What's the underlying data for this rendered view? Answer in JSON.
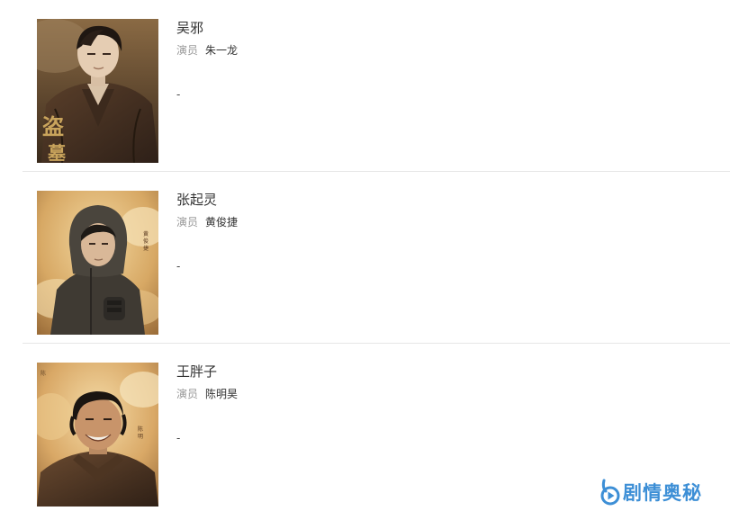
{
  "cast": [
    {
      "role": "吴邪",
      "actor_label": "演员",
      "actor": "朱一龙",
      "description": "-",
      "portrait_icon": "character-portrait-brown-coat",
      "poster_text": "盗墓"
    },
    {
      "role": "张起灵",
      "actor_label": "演员",
      "actor": "黄俊捷",
      "description": "-",
      "portrait_icon": "character-portrait-hooded"
    },
    {
      "role": "王胖子",
      "actor_label": "演员",
      "actor": "陈明昊",
      "description": "-",
      "portrait_icon": "character-portrait-leather-jacket"
    }
  ],
  "watermark": {
    "text": "剧情奥秘",
    "icon": "play-logo-icon",
    "color": "#3d8fd6"
  }
}
